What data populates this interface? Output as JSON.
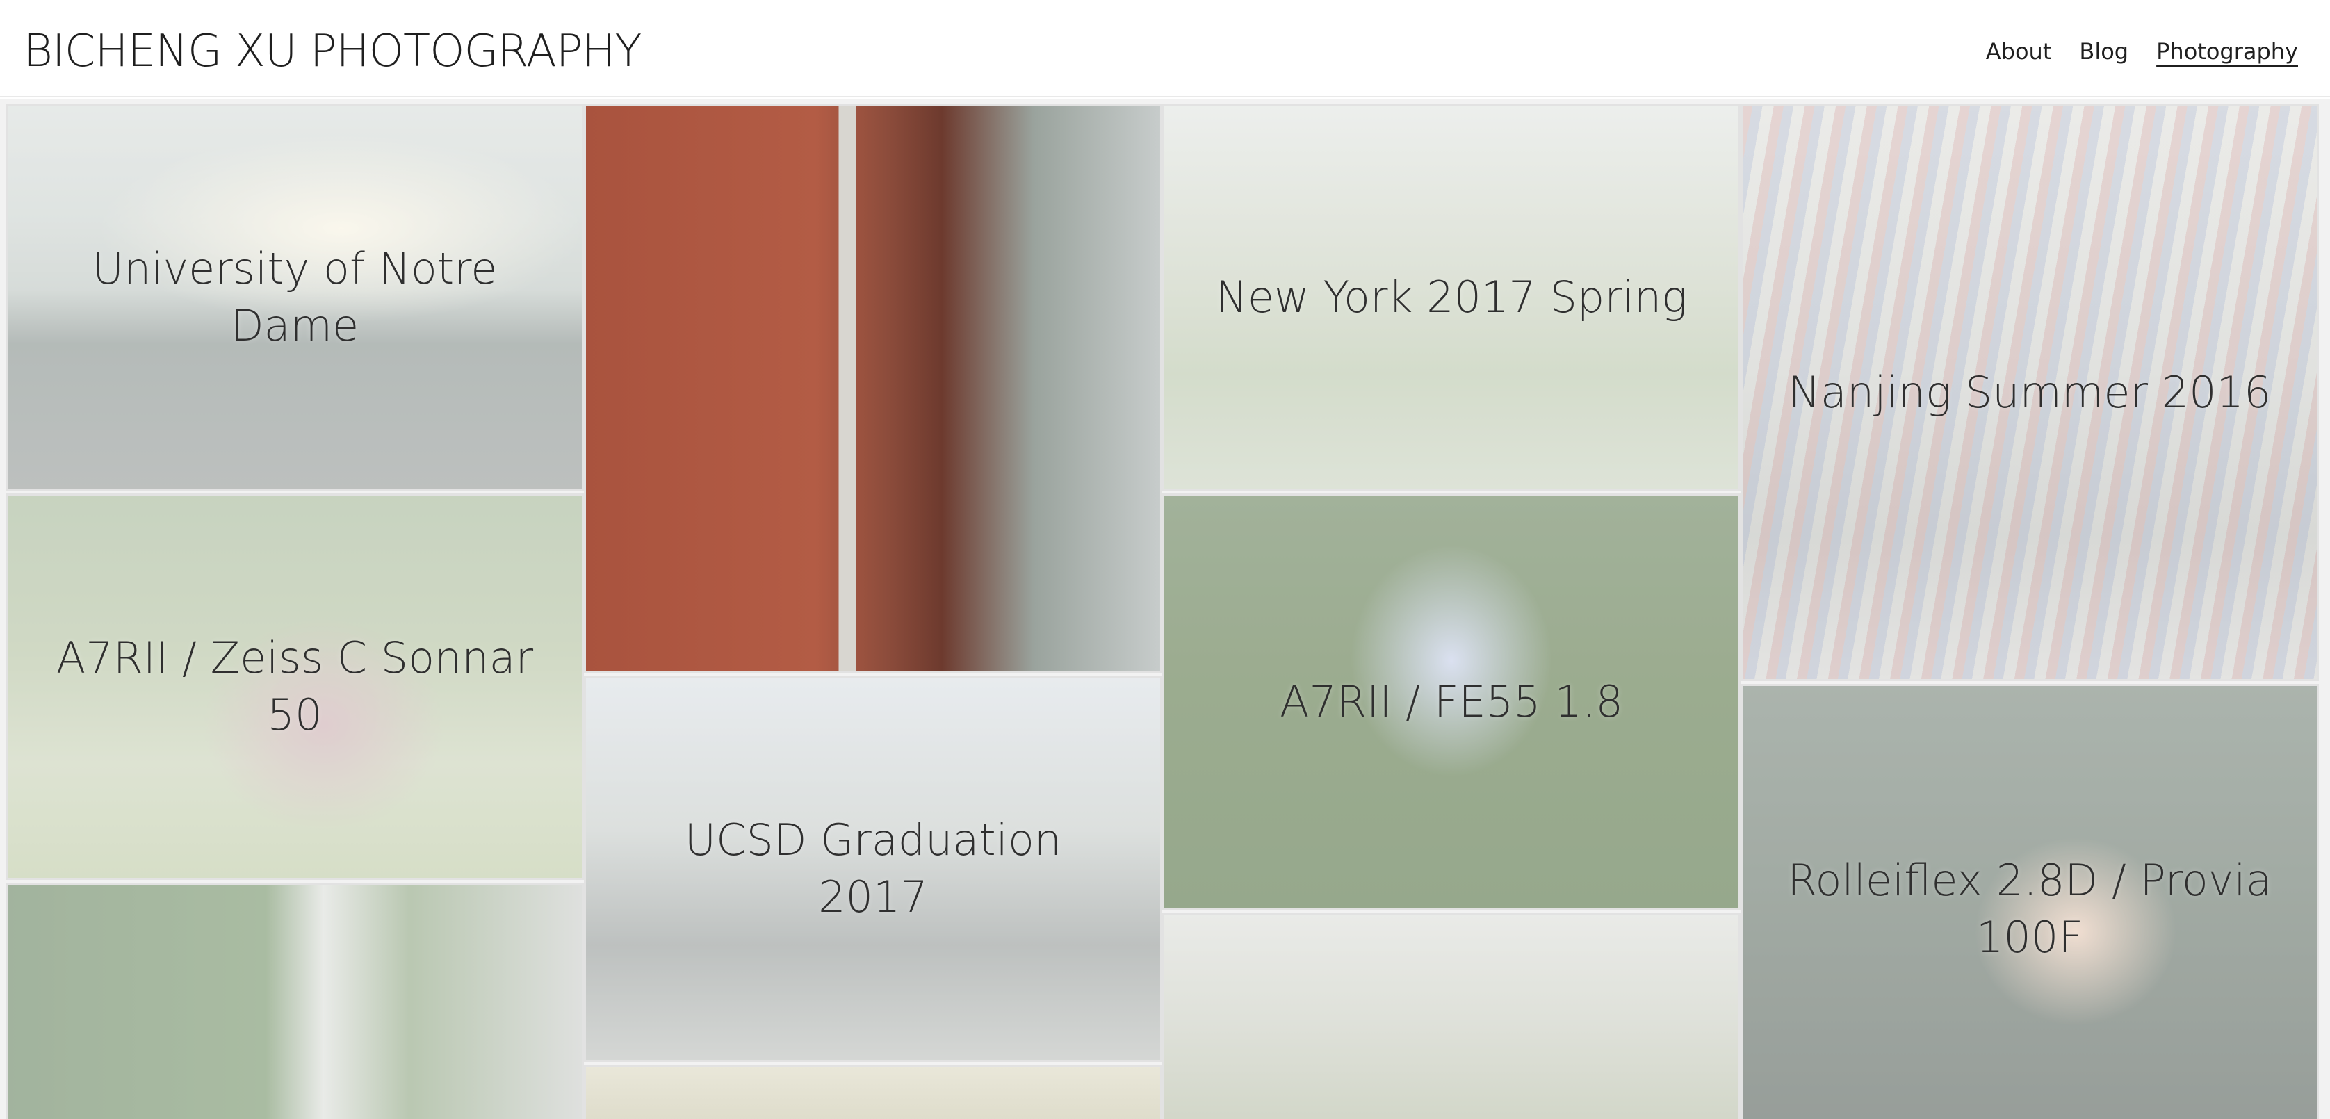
{
  "site": {
    "title": "BICHENG XU PHOTOGRAPHY"
  },
  "nav": [
    {
      "label": "About",
      "active": false
    },
    {
      "label": "Blog",
      "active": false
    },
    {
      "label": "Photography",
      "active": true
    }
  ],
  "gallery": {
    "tiles": [
      {
        "caption": "University of Notre Dame"
      },
      {
        "caption": ""
      },
      {
        "caption": "New York 2017 Spring"
      },
      {
        "caption": "Nanjing Summer 2016"
      },
      {
        "caption": "A7RII / Zeiss C Sonnar 50"
      },
      {
        "caption": "A7RII / FE55 1.8"
      },
      {
        "caption": "UCSD Graduation 2017"
      },
      {
        "caption": "Rolleiflex 2.8D / Provia 100F"
      },
      {
        "caption": ""
      },
      {
        "caption": ""
      },
      {
        "caption": ""
      }
    ]
  },
  "colors": {
    "background": "#ffffff",
    "text": "#1f1f1f",
    "tile_border": "#e2e2e2"
  }
}
